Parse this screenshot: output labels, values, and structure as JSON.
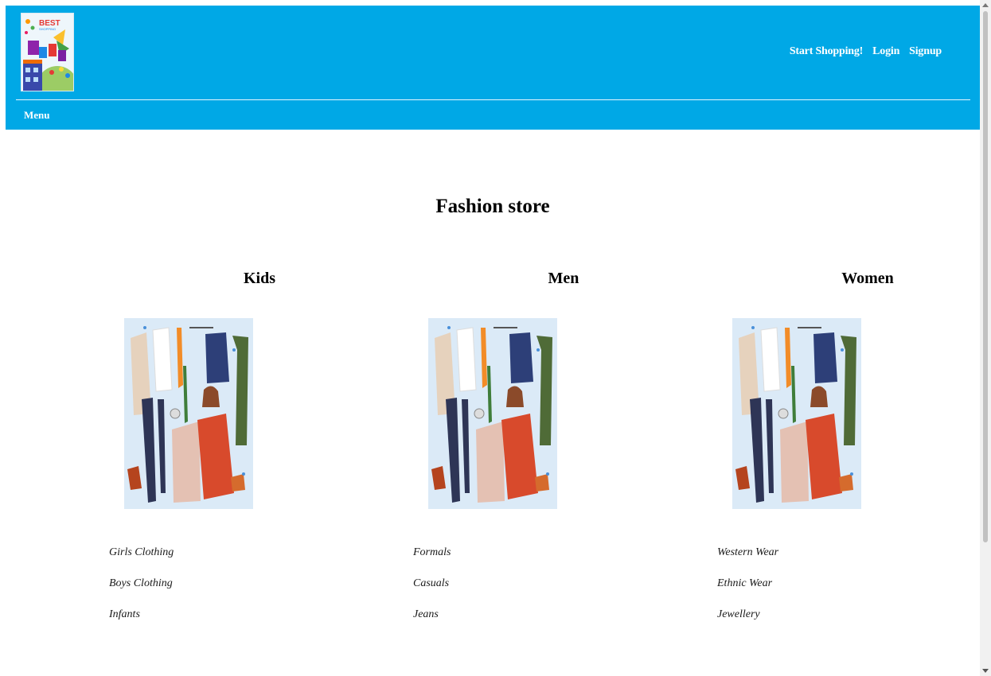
{
  "logo": {
    "text": "BEST SHOPPING"
  },
  "top_nav": [
    {
      "label": "Start Shopping!"
    },
    {
      "label": "Login"
    },
    {
      "label": "Signup"
    }
  ],
  "menu": {
    "label": "Menu"
  },
  "page_title": "Fashion store",
  "categories": [
    {
      "heading": "Kids",
      "links": [
        "Girls Clothing",
        "Boys Clothing",
        "Infants"
      ]
    },
    {
      "heading": "Men",
      "links": [
        "Formals",
        "Casuals",
        "Jeans"
      ]
    },
    {
      "heading": "Women",
      "links": [
        "Western Wear",
        "Ethnic Wear",
        "Jewellery"
      ]
    }
  ],
  "colors": {
    "header_bg": "#00a8e6",
    "text": "#000000"
  }
}
